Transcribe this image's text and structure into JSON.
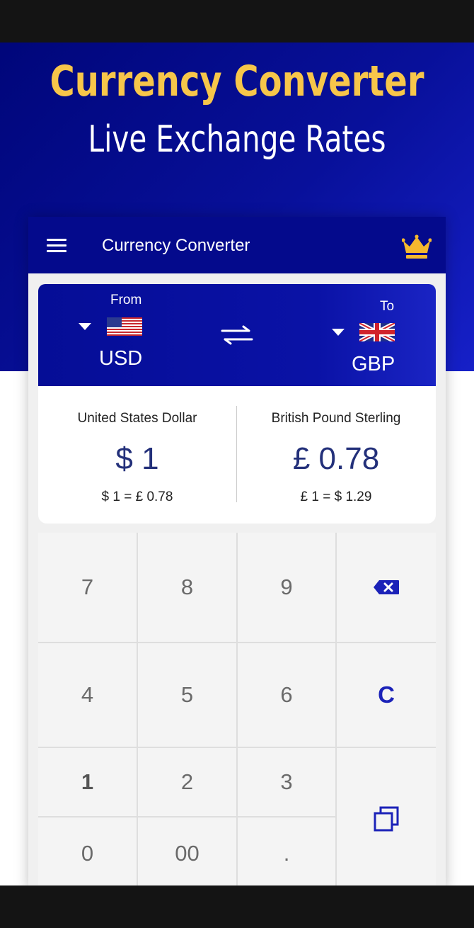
{
  "promo": {
    "title": "Currency Converter",
    "subtitle": "Live Exchange Rates"
  },
  "appbar": {
    "title": "Currency Converter",
    "menu_icon": "hamburger-menu-icon",
    "premium_icon": "crown-icon"
  },
  "converter": {
    "from_label": "From",
    "to_label": "To",
    "from_code": "USD",
    "to_code": "GBP",
    "from_flag": "us-flag-icon",
    "to_flag": "uk-flag-icon",
    "swap_icon": "swap-arrows-icon"
  },
  "values": {
    "from_name": "United States Dollar",
    "from_amount": "$ 1",
    "from_rate": "$ 1 =  £ 0.78",
    "to_name": "British Pound Sterling",
    "to_amount": "£ 0.78",
    "to_rate": "£ 1 =  $ 1.29"
  },
  "keypad": {
    "k7": "7",
    "k8": "8",
    "k9": "9",
    "k4": "4",
    "k5": "5",
    "k6": "6",
    "k1": "1",
    "k2": "2",
    "k3": "3",
    "k0": "0",
    "k00": "00",
    "kdot": ".",
    "clear": "C",
    "backspace_icon": "backspace-icon",
    "copy_icon": "copy-icon"
  },
  "colors": {
    "brand_blue": "#040a8c",
    "promo_yellow": "#f7c64a",
    "amount_text": "#23307a",
    "accent_key": "#1b22b8"
  }
}
